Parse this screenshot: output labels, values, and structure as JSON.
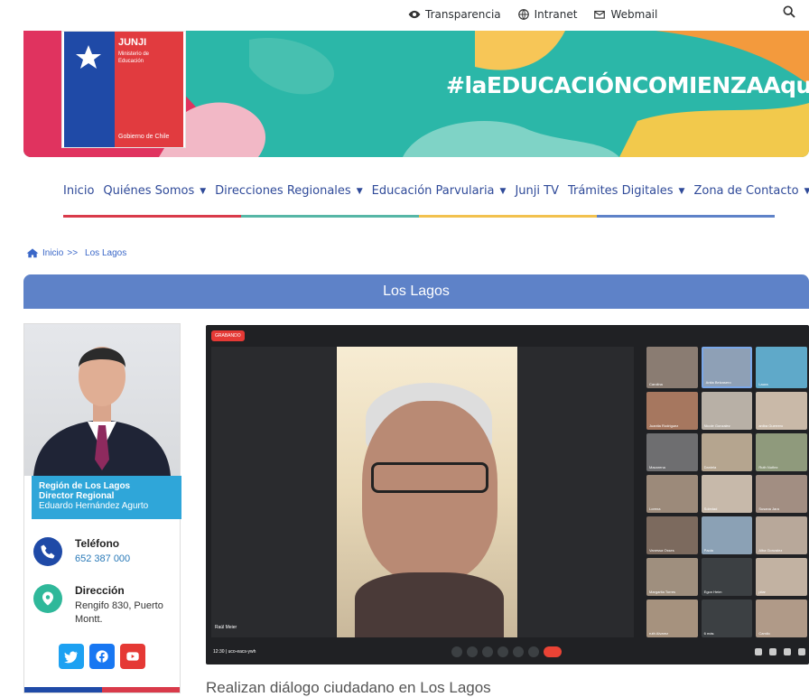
{
  "topbar": {
    "links": [
      {
        "label": "Transparencia",
        "icon": "eye-icon"
      },
      {
        "label": "Intranet",
        "icon": "globe-icon"
      },
      {
        "label": "Webmail",
        "icon": "mail-icon"
      }
    ],
    "search_icon": "search-icon"
  },
  "banner": {
    "logo_title": "JUNJI",
    "logo_subtitle_1": "Ministerio de",
    "logo_subtitle_2": "Educación",
    "logo_footer": "Gobierno de Chile",
    "hashtag": "#laEDUCACIÓNCOMIENZAAquí"
  },
  "nav": {
    "items": [
      {
        "label": "Inicio",
        "has_caret": false
      },
      {
        "label": "Quiénes Somos",
        "has_caret": true
      },
      {
        "label": "Direcciones Regionales",
        "has_caret": true
      },
      {
        "label": "Educación Parvularia",
        "has_caret": true
      },
      {
        "label": "Junji TV",
        "has_caret": false
      },
      {
        "label": "Trámites Digitales",
        "has_caret": true
      },
      {
        "label": "Zona de Contacto",
        "has_caret": true
      }
    ],
    "stripe_colors": [
      "#d93a4a",
      "#56b6a6",
      "#f2c14e",
      "#5e82c8"
    ]
  },
  "breadcrumb": {
    "home": "Inicio",
    "sep": ">>",
    "current": "Los Lagos"
  },
  "page": {
    "title": "Los Lagos"
  },
  "card": {
    "region": "Región de Los Lagos",
    "role": "Director Regional",
    "name": "Eduardo Hernández Agurto",
    "phone_label": "Teléfono",
    "phone_value": "652 387 000",
    "address_label": "Dirección",
    "address_value": "Rengifo 830, Puerto Montt.",
    "social": [
      {
        "icon": "twitter-icon",
        "color": "#1da1f2"
      },
      {
        "icon": "facebook-icon",
        "color": "#1877f2"
      },
      {
        "icon": "youtube-icon",
        "color": "#e53935"
      }
    ]
  },
  "video": {
    "rec_label": "GRABANDO",
    "speaker_name": "Raúl Meier",
    "meeting_code": "12:30 | uco-eacs-ywh",
    "tiles": [
      "Carolina",
      "Anita Belzasero",
      "Laura",
      "Juanita Rodriguez",
      "Nicole Gonzalez",
      "aniba Guerrero",
      "Macarena",
      "Daniela",
      "Ruth Nuñez",
      "Lorena",
      "Soledad",
      "Susana Jara",
      "Vanessa Osses",
      "Paola",
      "Alba Gonzalez",
      "Margarita Torres",
      "Egon Heim",
      "pilar",
      "ruth Alvarez",
      "6 más",
      "Camilo"
    ]
  },
  "article": {
    "title": "Realizan diálogo ciudadano en Los Lagos"
  }
}
